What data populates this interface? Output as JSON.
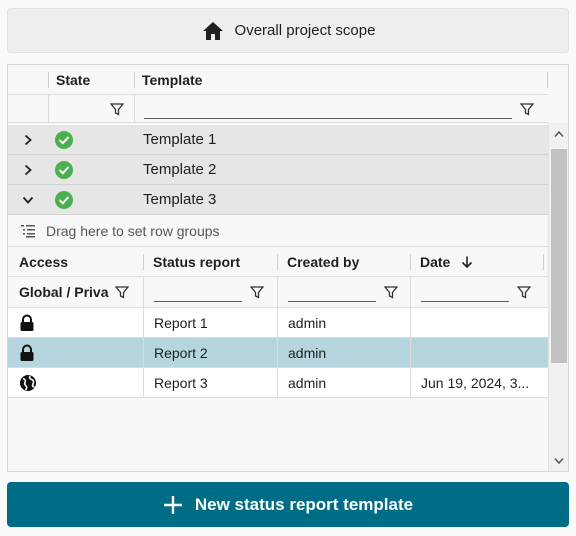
{
  "scope": {
    "label": "Overall project scope"
  },
  "grid": {
    "columns": {
      "state": "State",
      "template": "Template"
    },
    "groups": [
      {
        "name": "Template 1",
        "expanded": false
      },
      {
        "name": "Template 2",
        "expanded": false
      },
      {
        "name": "Template 3",
        "expanded": true
      }
    ]
  },
  "detail": {
    "drag_hint": "Drag here to set row groups",
    "columns": {
      "access": "Access",
      "status": "Status report",
      "created": "Created by",
      "date": "Date"
    },
    "access_filter": "Global / Priva",
    "rows": [
      {
        "access_icon": "lock-icon",
        "report": "Report 1",
        "created": "admin",
        "date": ""
      },
      {
        "access_icon": "lock-icon",
        "report": "Report 2",
        "created": "admin",
        "date": ""
      },
      {
        "access_icon": "globe-icon",
        "report": "Report 3",
        "created": "admin",
        "date": "Jun 19, 2024, 3..."
      }
    ]
  },
  "new_button": {
    "label": "New status report template"
  },
  "colors": {
    "accent": "#006d86",
    "selected_row": "#b5d6df",
    "state_ok": "#4caf50"
  }
}
